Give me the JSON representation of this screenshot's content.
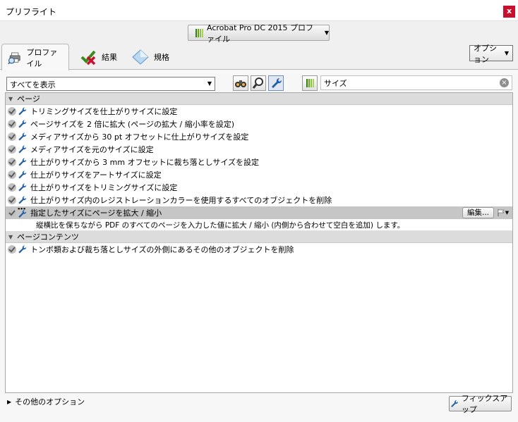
{
  "window": {
    "title": "プリフライト",
    "close_label": "x"
  },
  "profile_dropdown": {
    "label": "Acrobat Pro DC 2015 プロファイル"
  },
  "tabs": [
    {
      "label": "プロファイル",
      "active": true
    },
    {
      "label": "結果",
      "active": false
    },
    {
      "label": "規格",
      "active": false
    }
  ],
  "options_button": {
    "label": "オプション"
  },
  "filter": {
    "selected": "すべてを表示"
  },
  "search": {
    "value": "サイズ"
  },
  "sections": [
    {
      "title": "ページ",
      "items": [
        "トリミングサイズを仕上がりサイズに設定",
        "ページサイズを 2 倍に拡大 (ページの拡大 / 縮小率を設定)",
        "メディアサイズから 30 pt オフセットに仕上がりサイズを設定",
        "メディアサイズを元のサイズに設定",
        "仕上がりサイズから 3 mm オフセットに裁ち落としサイズを設定",
        "仕上がりサイズをアートサイズに設定",
        "仕上がりサイズをトリミングサイズに設定",
        "仕上がりサイズ内のレジストレーションカラーを使用するすべてのオブジェクトを削除"
      ],
      "selected_item": {
        "label": "指定したサイズにページを拡大 / 縮小",
        "edit_label": "編集...",
        "description": "縦横比を保ちながら PDF のすべてのページを入力した値に拡大 / 縮小 (内側から合わせて空白を追加) します。"
      }
    },
    {
      "title": "ページコンテンツ",
      "items": [
        "トンボ類および裁ち落としサイズの外側にあるその他のオブジェクトを削除"
      ]
    }
  ],
  "footer": {
    "more_options": "その他のオプション",
    "fixup_label": "フィックスアップ"
  },
  "colors": {
    "accent_green": "#6aa121",
    "close_red": "#c8102e",
    "wrench_blue": "#1f5ea8"
  }
}
